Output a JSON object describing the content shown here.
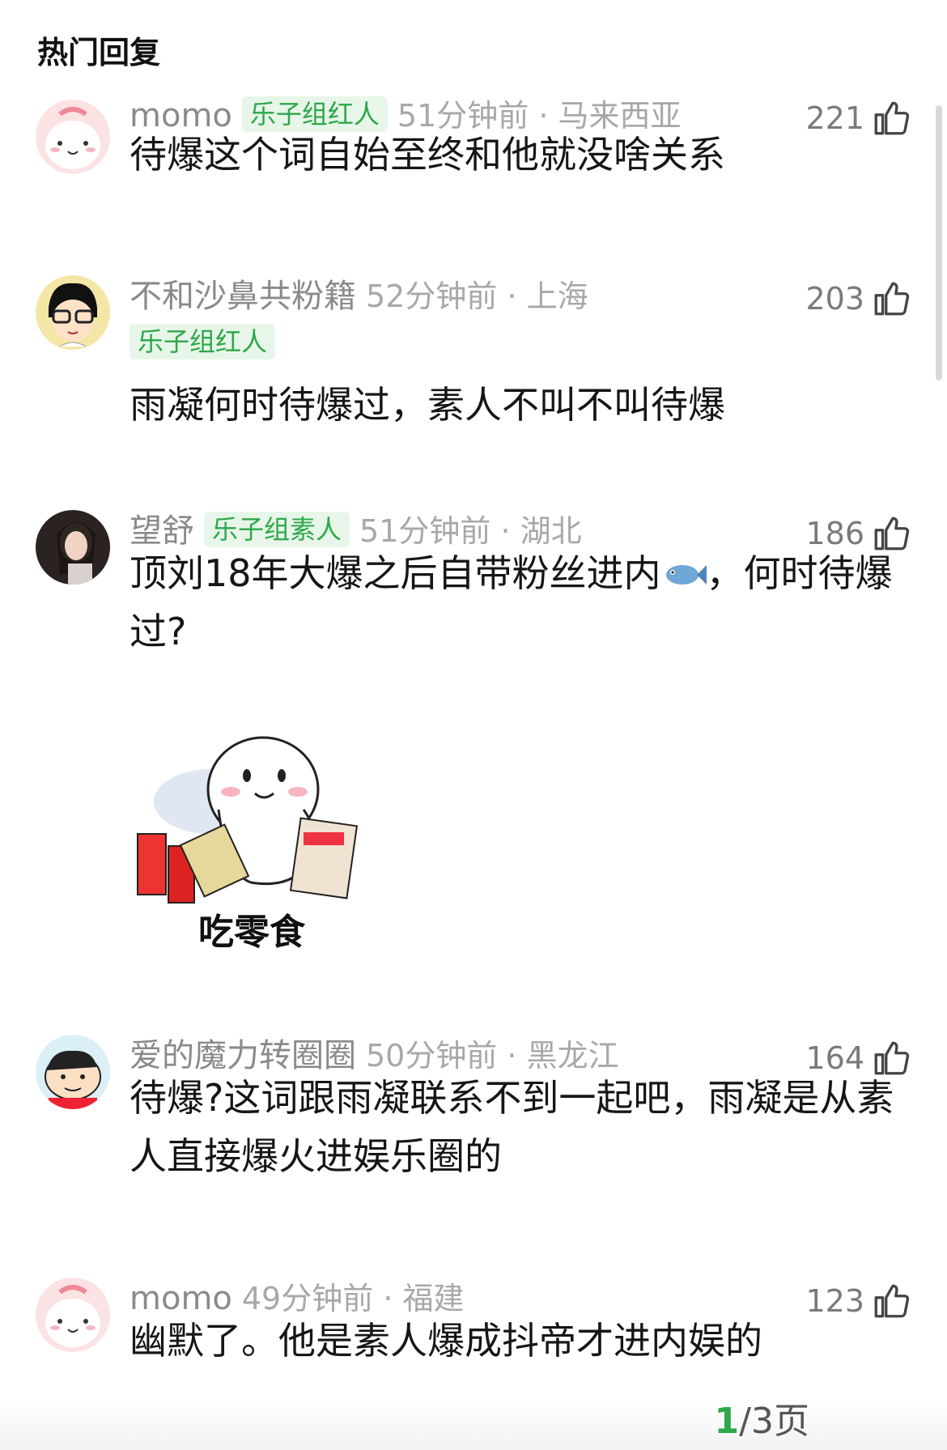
{
  "section_title": "热门回复",
  "comments": [
    {
      "username": "momo",
      "badge": "乐子组红人",
      "time_location": "51分钟前 · 马来西亚",
      "likes": "221",
      "text": "待爆这个词自始至终和他就没啥关系"
    },
    {
      "username": "不和沙鼻共粉籍",
      "badge": "乐子组红人",
      "time_location": "52分钟前 · 上海",
      "likes": "203",
      "text": "雨凝何时待爆过，素人不叫不叫待爆"
    },
    {
      "username": "望舒",
      "badge": "乐子组素人",
      "time_location": "51分钟前 · 湖北",
      "likes": "186",
      "text_part1": "顶刘18年大爆之后自带粉丝进内",
      "emoji_name": "fish-emoji",
      "text_part2": "，何时待爆过?",
      "sticker_caption": "吃零食"
    },
    {
      "username": "爱的魔力转圈圈",
      "time_location": "50分钟前 · 黑龙江",
      "likes": "164",
      "text": "待爆?这词跟雨凝联系不到一起吧，雨凝是从素人直接爆火进娱乐圈的"
    },
    {
      "username": "momo",
      "time_location": "49分钟前 · 福建",
      "likes": "123",
      "text": "幽默了。他是素人爆成抖帝才进内娱的"
    }
  ],
  "pager": {
    "current": "1",
    "rest": "/3页"
  },
  "colors": {
    "badge_bg": "#e7f6e8",
    "badge_text": "#2ea84a"
  },
  "icons": {
    "like": "thumbs-up-icon"
  }
}
